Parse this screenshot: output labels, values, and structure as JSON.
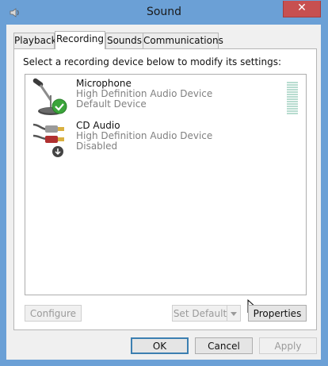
{
  "window": {
    "title": "Sound",
    "close_label": "✕"
  },
  "tabs": [
    {
      "label": "Playback",
      "active": false
    },
    {
      "label": "Recording",
      "active": true
    },
    {
      "label": "Sounds",
      "active": false
    },
    {
      "label": "Communications",
      "active": false
    }
  ],
  "panel": {
    "instruction": "Select a recording device below to modify its settings:"
  },
  "devices": [
    {
      "name": "Microphone",
      "driver": "High Definition Audio Device",
      "status": "Default Device",
      "icon": "microphone-icon",
      "badge": "check-badge"
    },
    {
      "name": "CD Audio",
      "driver": "High Definition Audio Device",
      "status": "Disabled",
      "icon": "rca-cable-icon",
      "badge": "disabled-badge"
    }
  ],
  "buttons": {
    "configure": "Configure",
    "set_default": "Set Default",
    "properties": "Properties",
    "ok": "OK",
    "cancel": "Cancel",
    "apply": "Apply"
  },
  "colors": {
    "titlebar": "#6ba0d6",
    "close": "#c75050",
    "check": "#3aa53a"
  }
}
